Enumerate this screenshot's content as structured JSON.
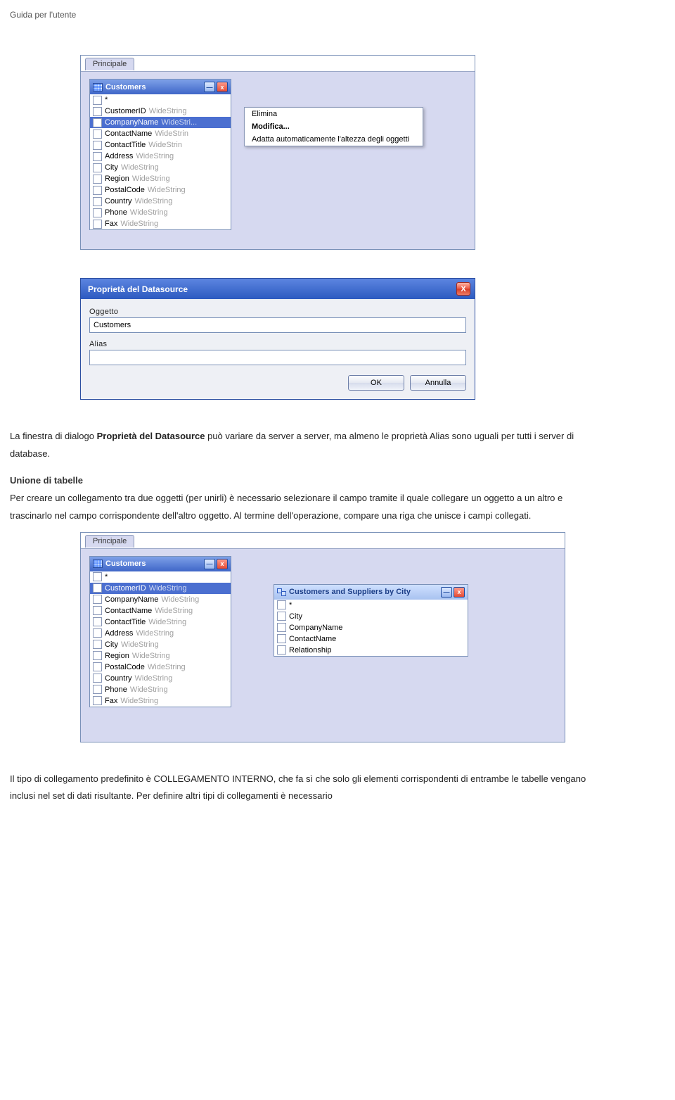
{
  "header": "Guida per l'utente",
  "screenshot1": {
    "tab": "Principale",
    "table_title": "Customers",
    "min_glyph": "—",
    "close_glyph": "x",
    "fields": [
      {
        "name": "*",
        "type": ""
      },
      {
        "name": "CustomerID",
        "type": "WideString"
      },
      {
        "name": "CompanyName",
        "type": "WideStri...",
        "selected": true
      },
      {
        "name": "ContactName",
        "type": "WideStrin"
      },
      {
        "name": "ContactTitle",
        "type": "WideStrin"
      },
      {
        "name": "Address",
        "type": "WideString"
      },
      {
        "name": "City",
        "type": "WideString"
      },
      {
        "name": "Region",
        "type": "WideString"
      },
      {
        "name": "PostalCode",
        "type": "WideString"
      },
      {
        "name": "Country",
        "type": "WideString"
      },
      {
        "name": "Phone",
        "type": "WideString"
      },
      {
        "name": "Fax",
        "type": "WideString"
      }
    ],
    "menu": {
      "elimina": "Elimina",
      "modifica": "Modifica...",
      "adatta": "Adatta automaticamente l'altezza degli oggetti"
    }
  },
  "dialog": {
    "title": "Proprietà del Datasource",
    "label_oggetto": "Oggetto",
    "value_oggetto": "Customers",
    "label_alias": "Alias",
    "value_alias": "",
    "ok": "OK",
    "cancel": "Annulla",
    "close_glyph": "X"
  },
  "para1_a": "La finestra di dialogo ",
  "para1_b": "Proprietà del Datasource",
  "para1_c": " può variare da server a server, ma almeno le proprietà Alias sono uguali per tutti i server di database.",
  "heading_union": "Unione di tabelle",
  "para2": "Per creare un collegamento tra due oggetti (per unirli) è necessario selezionare il campo tramite il quale collegare un oggetto a un altro e trascinarlo nel campo corrispondente dell'altro oggetto. Al termine dell'operazione, compare una riga che unisce i campi collegati.",
  "screenshot3": {
    "tab": "Principale",
    "table1": {
      "title": "Customers",
      "fields": [
        {
          "name": "*",
          "type": ""
        },
        {
          "name": "CustomerID",
          "type": "WideString",
          "selected": true
        },
        {
          "name": "CompanyName",
          "type": "WideString"
        },
        {
          "name": "ContactName",
          "type": "WideString"
        },
        {
          "name": "ContactTitle",
          "type": "WideString"
        },
        {
          "name": "Address",
          "type": "WideString"
        },
        {
          "name": "City",
          "type": "WideString"
        },
        {
          "name": "Region",
          "type": "WideString"
        },
        {
          "name": "PostalCode",
          "type": "WideString"
        },
        {
          "name": "Country",
          "type": "WideString"
        },
        {
          "name": "Phone",
          "type": "WideString"
        },
        {
          "name": "Fax",
          "type": "WideString"
        }
      ]
    },
    "table2": {
      "title": "Customers and Suppliers by City",
      "fields": [
        {
          "name": "*",
          "type": ""
        },
        {
          "name": "City",
          "type": ""
        },
        {
          "name": "CompanyName",
          "type": ""
        },
        {
          "name": "ContactName",
          "type": ""
        },
        {
          "name": "Relationship",
          "type": ""
        }
      ]
    },
    "min_glyph": "—",
    "close_glyph": "x"
  },
  "para3": "Il tipo di collegamento predefinito è COLLEGAMENTO INTERNO, che fa sì che solo gli elementi corrispondenti di entrambe le tabelle vengano inclusi nel set di dati risultante. Per definire altri tipi di collegamenti è necessario"
}
